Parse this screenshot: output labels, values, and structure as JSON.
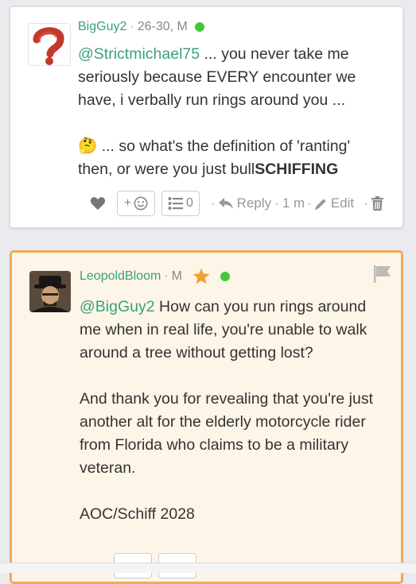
{
  "posts": [
    {
      "username": "BigGuy2",
      "meta": "26-30, M",
      "body": {
        "mention": "@Strictmichael75",
        "para1_rest": " ... you never take me seriously because EVERY encounter we have, i verbally run rings around you ...",
        "emoji": "🤔",
        "para2_prefix": " ... so what's the definition of 'ranting' then, or were you just bull",
        "para2_bold": "SCHIFFING"
      },
      "actions": {
        "react_label": "+",
        "list_count": "0",
        "reply_label": "Reply",
        "time": "1 m",
        "edit_label": "Edit"
      }
    },
    {
      "username": "LeopoldBloom",
      "meta": "M",
      "body": {
        "mention": "@BigGuy2",
        "para1_rest": " How can you run rings around me when in real life, you're unable to walk around a tree without getting lost?",
        "para2": "And thank you for revealing that you're just another alt for the elderly motorcycle rider from Florida who claims to be a military veteran.",
        "para3": "AOC/Schiff 2028"
      }
    }
  ],
  "bottom_bar_text": "                    ",
  "colors": {
    "username": "#3aa17e",
    "online": "#43c83b",
    "highlight_border": "#f0a95a",
    "highlight_bg": "#fdf5e8",
    "star": "#f0a030"
  }
}
